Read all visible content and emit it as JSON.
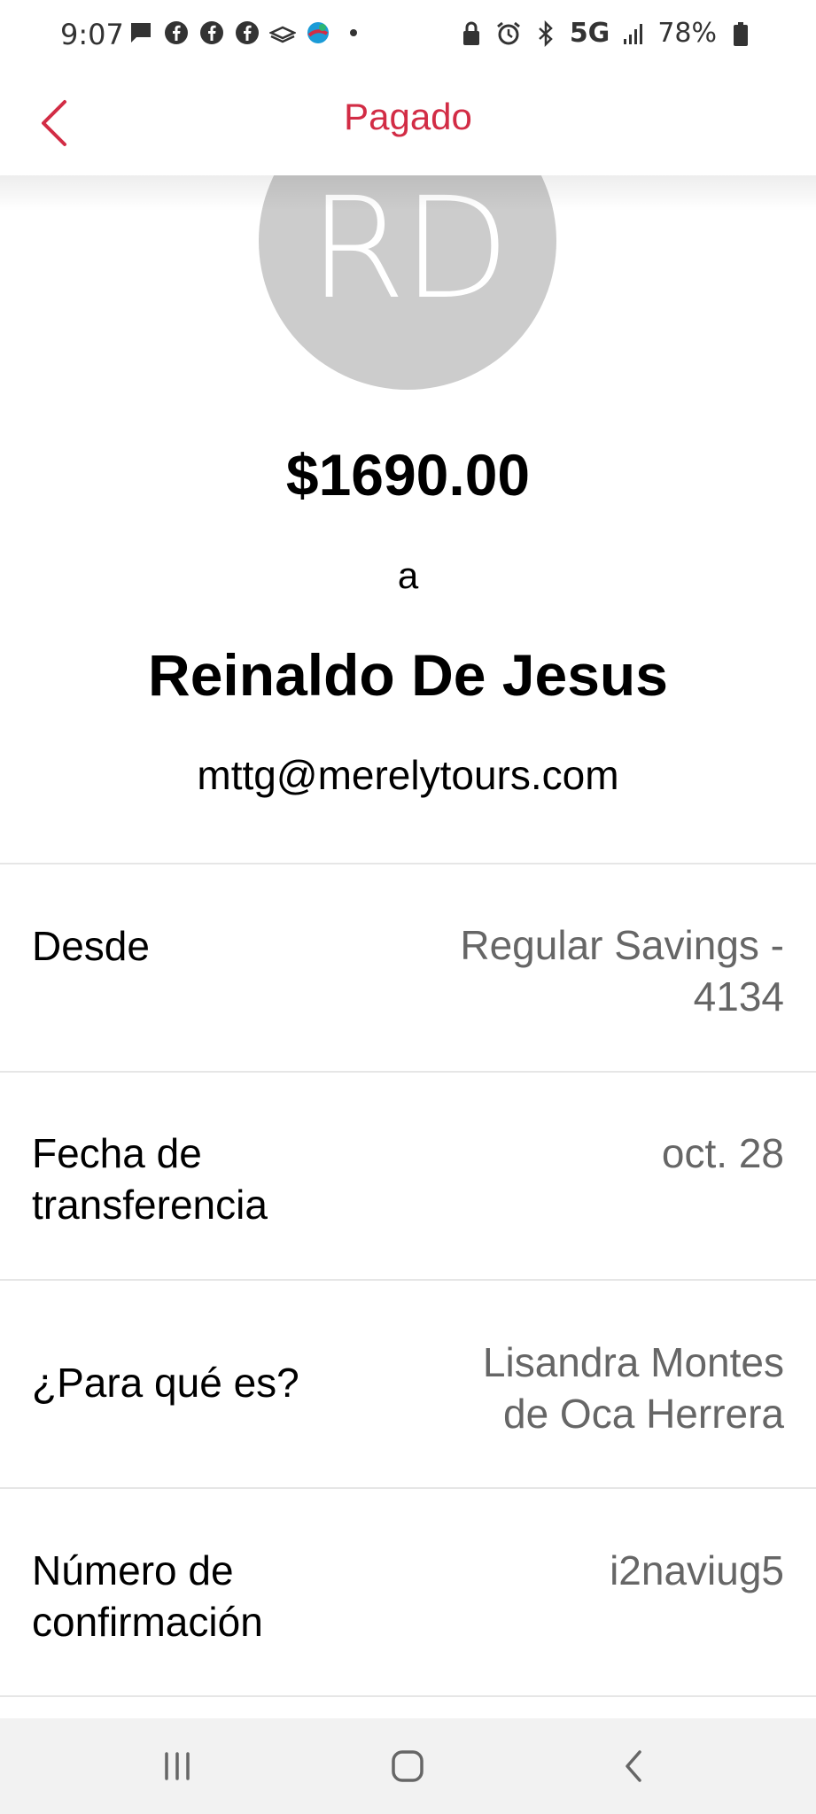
{
  "status_bar": {
    "time": "9:07",
    "left_icons": [
      "message-icon",
      "facebook-icon",
      "facebook-icon",
      "facebook-icon",
      "cast-icon",
      "app-icon",
      "dot-icon"
    ],
    "network": "5G",
    "battery": "78%"
  },
  "header": {
    "title": "Pagado",
    "back_icon": "chevron-left-icon"
  },
  "colors": {
    "accent": "#d22c45",
    "avatar_bg": "#cccccc",
    "value_text": "#666666"
  },
  "payment": {
    "avatar_initials": "RD",
    "amount": "$1690.00",
    "connector": "a",
    "recipient_name": "Reinaldo De Jesus",
    "recipient_email": "mttg@merelytours.com"
  },
  "details": [
    {
      "label": "Desde",
      "value": "Regular Savings - 4134"
    },
    {
      "label": "Fecha de transferencia",
      "value": "oct. 28"
    },
    {
      "label": "¿Para qué es?",
      "value": "Lisandra Montes de Oca Herrera"
    },
    {
      "label": "Número de confirmación",
      "value": "i2naviug5"
    }
  ],
  "nav": {
    "icons": [
      "recent-apps-icon",
      "home-icon",
      "back-icon"
    ]
  }
}
